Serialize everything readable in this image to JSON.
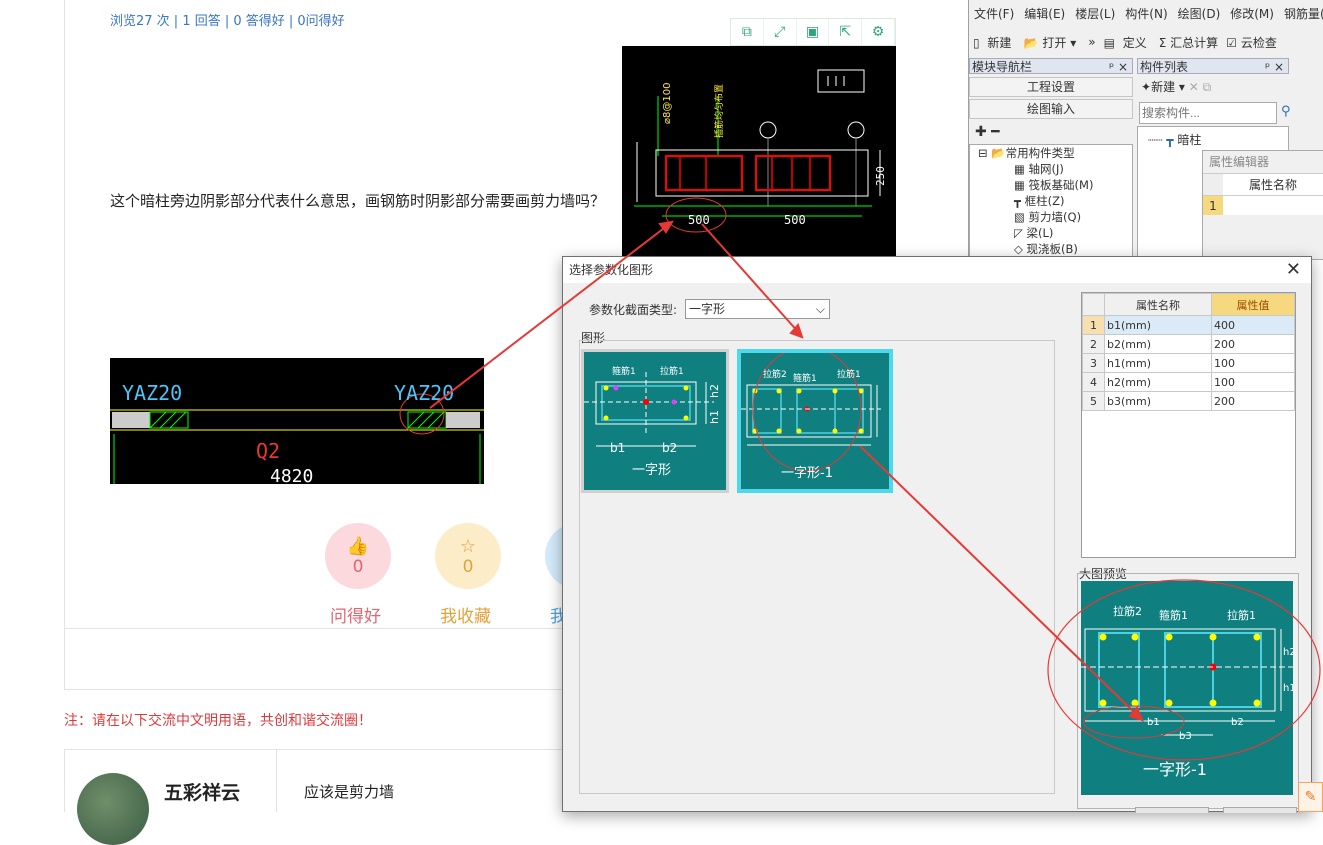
{
  "forum": {
    "stats": "浏览27 次 | 1 回答 | 0 答得好 | 0问得好",
    "question": "这个暗柱旁边阴影部分代表什么意思，画钢筋时阴影部分需要画剪力墙吗？",
    "buttons": [
      {
        "count": "0",
        "label": "问得好",
        "color": "#e56473",
        "bg": "#fbd9dd"
      },
      {
        "count": "0",
        "label": "我收藏",
        "color": "#e3a23a",
        "bg": "#fdecc8"
      },
      {
        "count": "",
        "label": "我",
        "color": "#4aa3df",
        "bg": "#d3ebfa"
      }
    ],
    "notice": "注：请在以下交流中文明用语，共创和谐交流圈！",
    "user_name": "五彩祥云",
    "answer": "应该是剪力墙"
  },
  "cad_top": {
    "rebar_label": "⌀8@100",
    "note_label": "插筋均匀布置",
    "dim_1": "500",
    "dim_2": "500",
    "dim_v": "250"
  },
  "cad_bottom": {
    "label_left": "YAZ20",
    "label_right": "YAZ20",
    "wall": "Q2",
    "length": "4820"
  },
  "app": {
    "menu": [
      "文件(F)",
      "编辑(E)",
      "楼层(L)",
      "构件(N)",
      "绘图(D)",
      "修改(M)",
      "钢筋量(C"
    ],
    "toolbar": [
      "新建",
      "打开 ▾",
      "»",
      "定义",
      "Σ 汇总计算",
      "云检查"
    ],
    "nav_title": "模块导航栏",
    "comp_title": "构件列表",
    "nav_buttons": [
      "工程设置",
      "绘图输入"
    ],
    "new_btn": "新建",
    "search_placeholder": "搜索构件...",
    "comp_item": "暗柱",
    "prop_editor": "属性编辑器",
    "prop_name_header": "属性名称",
    "prop_row_idx": "1",
    "tree": [
      "常用构件类型",
      "轴网(J)",
      "筏板基础(M)",
      "框柱(Z)",
      "剪力墙(Q)",
      "梁(L)",
      "现浇板(B)"
    ]
  },
  "dialog": {
    "title": "选择参数化图形",
    "type_label": "参数化截面类型:",
    "type_value": "一字形",
    "shapes_label": "图形",
    "shape1": {
      "name": "一字形",
      "l1": "箍筋1",
      "l2": "拉筋1",
      "b1": "b1",
      "b2": "b2",
      "h1": "h1",
      "h2": "h2"
    },
    "shape2": {
      "name": "一字形-1",
      "l1": "拉筋2",
      "l2": "箍筋1",
      "l3": "拉筋1"
    },
    "props_headers": [
      "属性名称",
      "属性值"
    ],
    "props": [
      {
        "idx": "1",
        "name": "b1(mm)",
        "value": "400"
      },
      {
        "idx": "2",
        "name": "b2(mm)",
        "value": "200"
      },
      {
        "idx": "3",
        "name": "h1(mm)",
        "value": "100"
      },
      {
        "idx": "4",
        "name": "h2(mm)",
        "value": "100"
      },
      {
        "idx": "5",
        "name": "b3(mm)",
        "value": "200"
      }
    ],
    "preview_label": "大图预览",
    "preview": {
      "name": "一字形-1",
      "l1": "拉筋2",
      "l2": "箍筋1",
      "l3": "拉筋1",
      "b1": "b1",
      "b2": "b2",
      "b3": "b3",
      "h1": "h1",
      "h2": "h2"
    }
  },
  "colors": {
    "teal": "#0f7f7f",
    "link": "#3a76c4",
    "alert": "#e0393c",
    "annotation": "#e53935"
  }
}
